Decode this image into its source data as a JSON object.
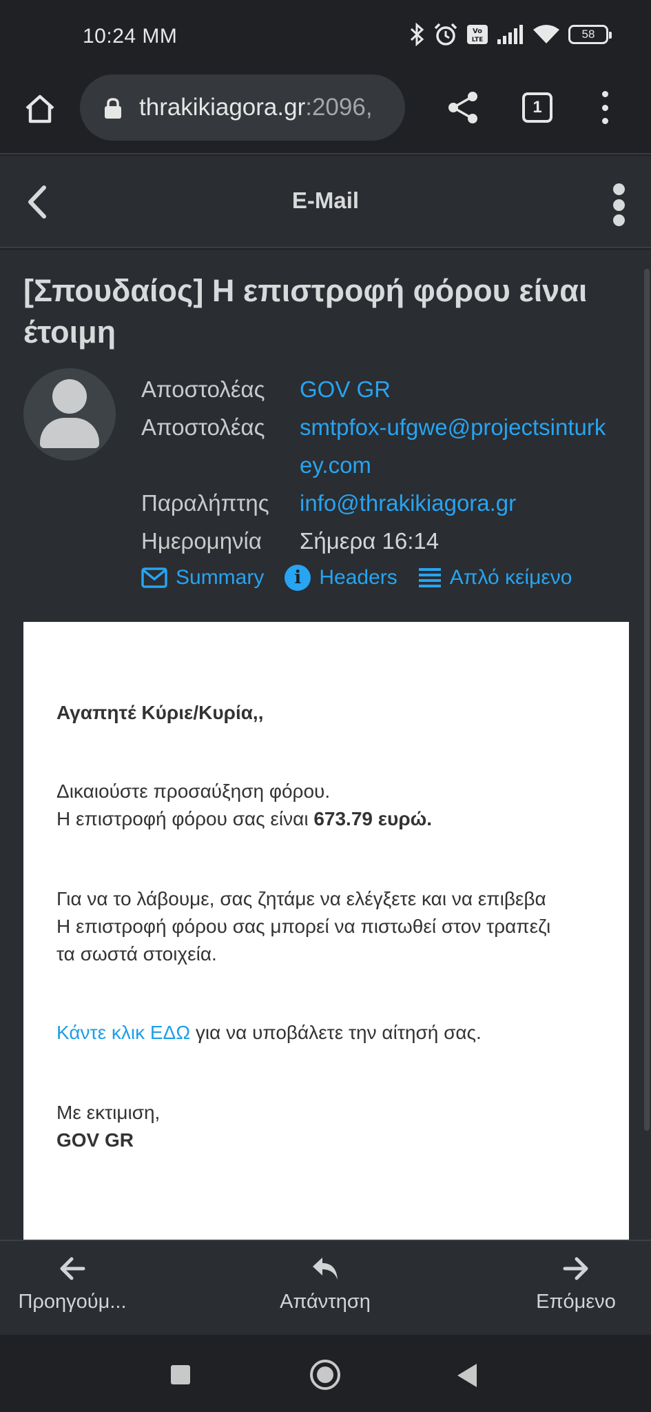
{
  "status_bar": {
    "time": "10:24 MM",
    "battery": "58",
    "icons": [
      "bluetooth-icon",
      "alarm-icon",
      "volte-icon",
      "signal-icon",
      "wifi-icon",
      "battery-icon"
    ]
  },
  "browser": {
    "url_host": "thrakikiagora.gr",
    "url_port": ":2096,",
    "tab_count": "1"
  },
  "app": {
    "title": "E-Mail"
  },
  "email": {
    "subject": "[Σπουδαίος] Η επιστροφή φόρου είναι έτοιμη",
    "meta": [
      {
        "label": "Αποστολέας",
        "value": "GOV GR"
      },
      {
        "label": "Αποστολέας",
        "value": "smtpfox-ufgwe@projectsinturkey.com"
      },
      {
        "label": "Παραλήπτης",
        "value": "info@thrakikiagora.gr"
      },
      {
        "label": "Ημερομηνία",
        "value": "Σήμερα 16:14"
      }
    ],
    "actions": {
      "summary": "Summary",
      "headers": "Headers",
      "plain_text": "Απλό κείμενο"
    },
    "body": {
      "greeting": "Αγαπητέ Κύριε/Κυρία,,",
      "line1": "Δικαιούστε προσαύξηση φόρου.",
      "line2_prefix": "Η επιστροφή φόρου σας είναι ",
      "line2_amount": "673.79 ευρώ.",
      "line3": "Για να το λάβουμε, σας ζητάμε να ελέγξετε και να επιβεβα",
      "line4": "Η επιστροφή φόρου σας μπορεί να πιστωθεί στον τραπεζι",
      "line5": "τα σωστά στοιχεία.",
      "link_text": "Κάντε κλικ ΕΔΩ",
      "link_suffix": " για να υποβάλετε την αίτησή σας.",
      "closing": "Με εκτιμιση,",
      "signature": "GOV GR"
    }
  },
  "bottom_nav": {
    "previous": "Προηγούμ...",
    "reply": "Απάντηση",
    "next": "Επόμενο"
  },
  "colors": {
    "link": "#27a4f2",
    "background": "#2a2d31"
  }
}
